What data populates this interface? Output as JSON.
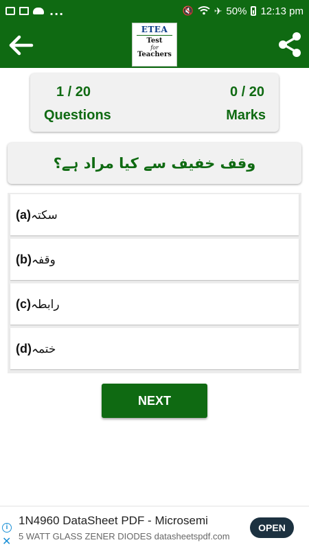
{
  "status_bar": {
    "battery": "50%",
    "time": "12:13 pm",
    "dots": "..."
  },
  "app_bar": {
    "logo_title": "ETEA",
    "logo_line1": "Test",
    "logo_line2": "for",
    "logo_line3": "Teachers"
  },
  "score": {
    "questions_value": "1 / 20",
    "questions_label": "Questions",
    "marks_value": "0 / 20",
    "marks_label": "Marks"
  },
  "question": {
    "text": "وقف خفیف سے کیا مراد ہے؟"
  },
  "options": [
    {
      "letter": "(a)",
      "text": "سکتہ"
    },
    {
      "letter": "(b)",
      "text": "وقفہ"
    },
    {
      "letter": "(c)",
      "text": "رابطہ"
    },
    {
      "letter": "(d)",
      "text": "ختمہ"
    }
  ],
  "next_button": {
    "label": "NEXT"
  },
  "ad": {
    "title": "1N4960 DataSheet PDF - Microsemi",
    "subtitle": "5 WATT GLASS ZENER DIODES datasheetspdf.com",
    "open_label": "OPEN"
  },
  "colors": {
    "brand_green": "#0f6a12",
    "card_gray": "#f1f1f1",
    "ad_button": "#1c3140"
  }
}
